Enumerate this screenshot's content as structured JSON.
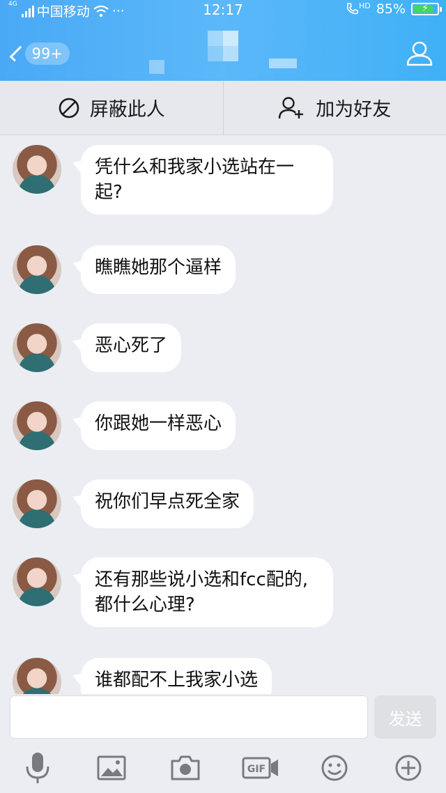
{
  "status_bar": {
    "network_tag": "4G",
    "carrier": "中国移动",
    "more": "···",
    "time": "12:17",
    "hd_tag": "HD",
    "battery": "85%",
    "battery_level": 0.85,
    "battery_color": "#44d85a"
  },
  "header": {
    "unread_badge": "99+"
  },
  "actions": {
    "block_label": "屏蔽此人",
    "add_friend_label": "加为好友"
  },
  "messages": [
    {
      "text": "凭什么和我家小选站在一\n起?"
    },
    {
      "text": "瞧瞧她那个逼样"
    },
    {
      "text": "恶心死了"
    },
    {
      "text": "你跟她一样恶心"
    },
    {
      "text": "祝你们早点死全家"
    },
    {
      "text": "还有那些说小选和fcc配的,\n都什么心理?"
    },
    {
      "text": "谁都配不上我家小选"
    }
  ],
  "input": {
    "send_label": "发送",
    "tools": [
      "microphone-icon",
      "image-icon",
      "camera-icon",
      "gif-icon",
      "emoji-icon",
      "plus-icon"
    ],
    "gif_label": "GIF"
  },
  "colors": {
    "header_blue": "#4aa9f6",
    "bubble": "#ffffff",
    "background": "#ebedf3"
  }
}
